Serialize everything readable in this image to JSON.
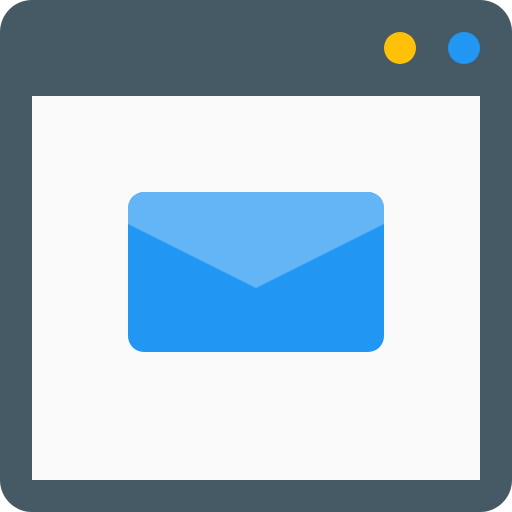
{
  "window": {
    "frame_color": "#455A64",
    "content_color": "#FAFAFA",
    "controls": [
      {
        "name": "yellow-dot",
        "color": "#FFC107"
      },
      {
        "name": "blue-dot",
        "color": "#2196F3"
      }
    ]
  },
  "main": {
    "icon": "mail-envelope-icon",
    "envelope_colors": {
      "body": "#2196F3",
      "flap": "#64B5F6"
    }
  }
}
